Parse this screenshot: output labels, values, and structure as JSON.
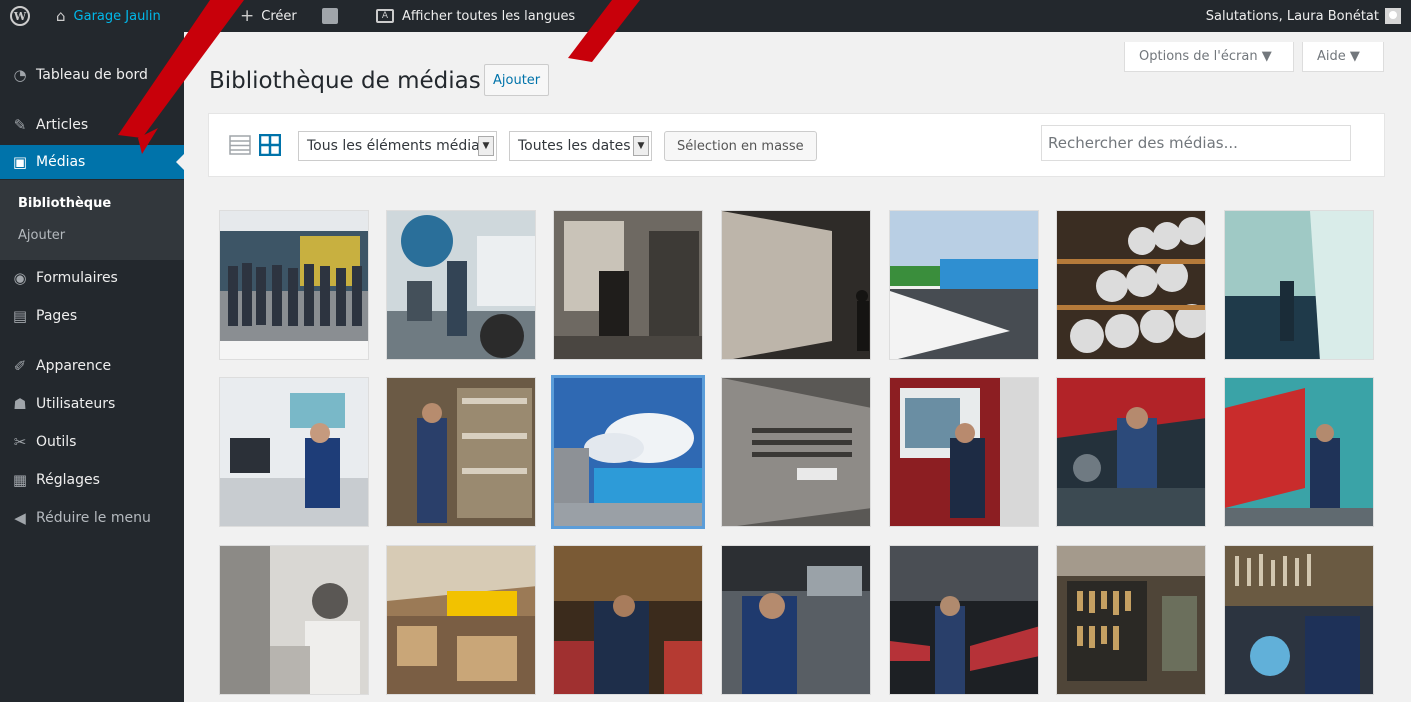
{
  "adminbar": {
    "site_name": "Garage Jaulin",
    "new_label": "Créer",
    "languages_label": "Afficher toutes les langues",
    "greeting": "Salutations, Laura Bonétat"
  },
  "sidebar": {
    "items": [
      {
        "label": "Tableau de bord",
        "icon": "dashboard-icon"
      },
      {
        "label": "Articles",
        "icon": "pin-icon"
      },
      {
        "label": "Médias",
        "icon": "media-icon",
        "active": true
      },
      {
        "label": "Formulaires",
        "icon": "forms-icon"
      },
      {
        "label": "Pages",
        "icon": "pages-icon"
      },
      {
        "label": "Apparence",
        "icon": "brush-icon"
      },
      {
        "label": "Utilisateurs",
        "icon": "users-icon"
      },
      {
        "label": "Outils",
        "icon": "wrench-icon"
      },
      {
        "label": "Réglages",
        "icon": "settings-icon"
      },
      {
        "label": "Réduire le menu",
        "icon": "collapse-icon"
      }
    ],
    "submenu": [
      {
        "label": "Bibliothèque",
        "current": true
      },
      {
        "label": "Ajouter"
      }
    ]
  },
  "header": {
    "title": "Bibliothèque de médias",
    "add_label": "Ajouter",
    "screen_options": "Options de l'écran ▼",
    "help": "Aide ▼"
  },
  "toolbar": {
    "filter_type": "Tous les éléments média",
    "filter_date": "Toutes les dates",
    "bulk_select": "Sélection en masse",
    "search_placeholder": "Rechercher des médias..."
  },
  "colors": {
    "accent": "#0073aa",
    "adminbar_bg": "#23282d",
    "annotation_arrow": "#c8000a"
  }
}
